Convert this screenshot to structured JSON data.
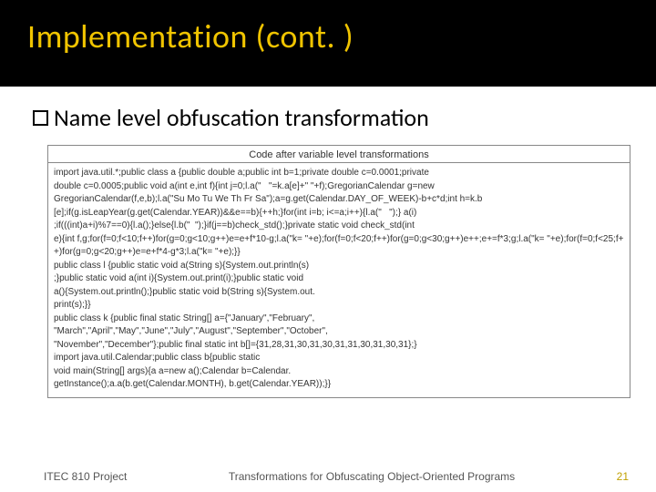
{
  "title": "Implementation (cont. )",
  "bullet": "Name level obfuscation transformation",
  "code": {
    "caption": "Code after variable level transformations",
    "body": "import java.util.*;public class a {public double a;public int b=1;private double c=0.0001;private\ndouble c=0.0005;public void a(int e,int f){int j=0;l.a(\"   \"=k.a[e]+\" \"+f);GregorianCalendar g=new\nGregorianCalendar(f,e,b);l.a(\"Su Mo Tu We Th Fr Sa\");a=g.get(Calendar.DAY_OF_WEEK)-b+c*d;int h=k.b\n[e];if(g.isLeapYear(g.get(Calendar.YEAR))&&e==b){++h;}for(int i=b; i<=a;i++){l.a(\"   \");} a(i)\n;if(((int)a+i)%7==0){l.a();}else{l.b(\"  \");}if(j==b)check_std();}private static void check_std(int\ne){int f,g;for(f=0;f<10;f++)for(g=0;g<10;g++)e=e+f*10-g;l.a(\"k= \"+e);for(f=0;f<20;f++)for(g=0;g<30;g++)e++;e+=f*3;g;l.a(\"k= \"+e);for(f=0;f<25;f++)for(g=0;g<20;g++)e=e+f*4-g*3;l.a(\"k= \"+e);}}\npublic class l {public static void a(String s){System.out.println(s)\n;}public static void a(int i){System.out.print(i);}public static void\na(){System.out.println();}public static void b(String s){System.out.\nprint(s);}}\npublic class k {public final static String[] a={\"January\",\"February\",\n\"March\",\"April\",\"May\",\"June\",\"July\",\"August\",\"September\",\"October\",\n\"November\",\"December\"};public final static int b[]={31,28,31,30,31,30,31,31,30,31,30,31};}\nimport java.util.Calendar;public class b{public static\nvoid main(String[] args){a a=new a();Calendar b=Calendar.\ngetInstance();a.a(b.get(Calendar.MONTH), b.get(Calendar.YEAR));}}"
  },
  "footer": {
    "left": "ITEC 810 Project",
    "center": "Transformations for Obfuscating Object-Oriented Programs",
    "page": "21"
  }
}
